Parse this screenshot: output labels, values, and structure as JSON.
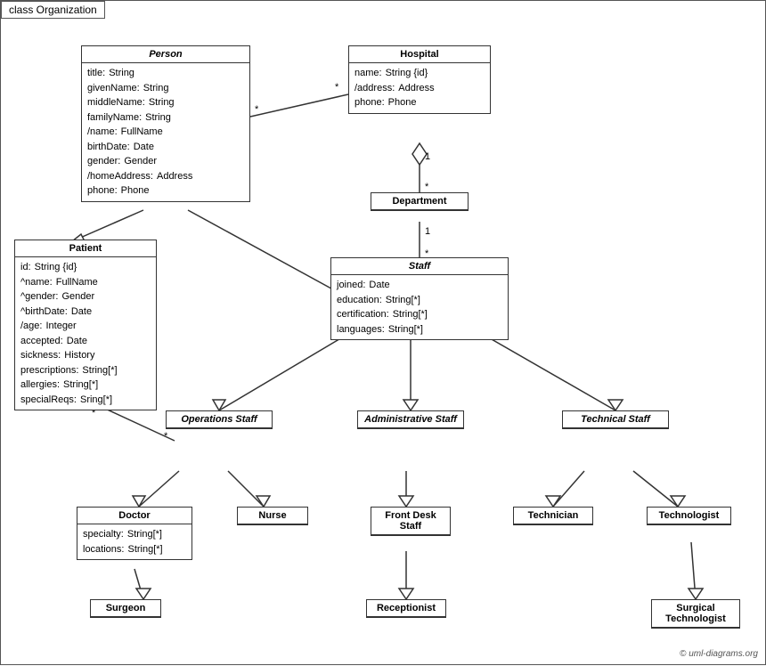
{
  "title": "class Organization",
  "classes": {
    "person": {
      "name": "Person",
      "italic": true,
      "attrs": [
        [
          "title:",
          "String"
        ],
        [
          "givenName:",
          "String"
        ],
        [
          "middleName:",
          "String"
        ],
        [
          "familyName:",
          "String"
        ],
        [
          "/name:",
          "FullName"
        ],
        [
          "birthDate:",
          "Date"
        ],
        [
          "gender:",
          "Gender"
        ],
        [
          "/homeAddress:",
          "Address"
        ],
        [
          "phone:",
          "Phone"
        ]
      ]
    },
    "hospital": {
      "name": "Hospital",
      "italic": false,
      "attrs": [
        [
          "name:",
          "String {id}"
        ],
        [
          "/address:",
          "Address"
        ],
        [
          "phone:",
          "Phone"
        ]
      ]
    },
    "department": {
      "name": "Department",
      "italic": false,
      "attrs": []
    },
    "staff": {
      "name": "Staff",
      "italic": true,
      "attrs": [
        [
          "joined:",
          "Date"
        ],
        [
          "education:",
          "String[*]"
        ],
        [
          "certification:",
          "String[*]"
        ],
        [
          "languages:",
          "String[*]"
        ]
      ]
    },
    "patient": {
      "name": "Patient",
      "italic": false,
      "attrs": [
        [
          "id:",
          "String {id}"
        ],
        [
          "^name:",
          "FullName"
        ],
        [
          "^gender:",
          "Gender"
        ],
        [
          "^birthDate:",
          "Date"
        ],
        [
          "/age:",
          "Integer"
        ],
        [
          "accepted:",
          "Date"
        ],
        [
          "sickness:",
          "History"
        ],
        [
          "prescriptions:",
          "String[*]"
        ],
        [
          "allergies:",
          "String[*]"
        ],
        [
          "specialReqs:",
          "Sring[*]"
        ]
      ]
    },
    "operations_staff": {
      "name": "Operations Staff",
      "italic": true,
      "attrs": []
    },
    "administrative_staff": {
      "name": "Administrative Staff",
      "italic": true,
      "attrs": []
    },
    "technical_staff": {
      "name": "Technical Staff",
      "italic": true,
      "attrs": []
    },
    "doctor": {
      "name": "Doctor",
      "italic": false,
      "attrs": [
        [
          "specialty:",
          "String[*]"
        ],
        [
          "locations:",
          "String[*]"
        ]
      ]
    },
    "nurse": {
      "name": "Nurse",
      "italic": false,
      "attrs": []
    },
    "front_desk_staff": {
      "name": "Front Desk Staff",
      "italic": false,
      "attrs": []
    },
    "technician": {
      "name": "Technician",
      "italic": false,
      "attrs": []
    },
    "technologist": {
      "name": "Technologist",
      "italic": false,
      "attrs": []
    },
    "surgeon": {
      "name": "Surgeon",
      "italic": false,
      "attrs": []
    },
    "receptionist": {
      "name": "Receptionist",
      "italic": false,
      "attrs": []
    },
    "surgical_technologist": {
      "name": "Surgical Technologist",
      "italic": false,
      "attrs": []
    }
  },
  "copyright": "© uml-diagrams.org"
}
